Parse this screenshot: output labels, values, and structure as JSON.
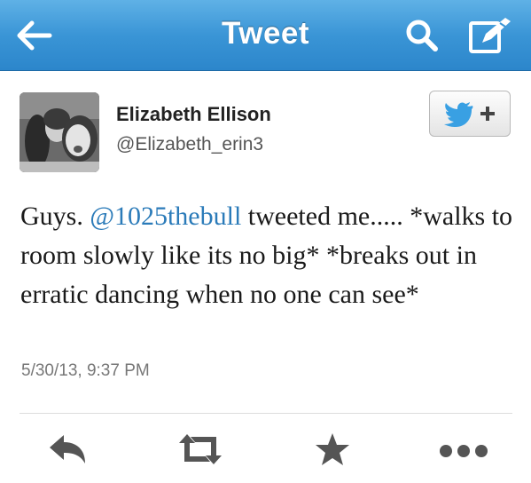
{
  "navbar": {
    "title": "Tweet",
    "background_color": "#3a95d6",
    "icons": [
      "back-arrow-icon",
      "search-icon",
      "compose-icon"
    ]
  },
  "tweet": {
    "user": {
      "name": "Elizabeth Ellison",
      "handle": "@Elizabeth_erin3"
    },
    "follow_icon": "twitter-bird-plus-icon",
    "text_before_mention": "Guys. ",
    "mention": "@1025thebull",
    "text_after_mention": " tweeted me..... *walks to room slowly like its no big* *breaks out in erratic dancing when no one can see*",
    "mention_color": "#2b7bb9",
    "timestamp": "5/30/13, 9:37 PM"
  },
  "actions": {
    "icons": [
      "reply-icon",
      "retweet-icon",
      "favorite-star-icon",
      "more-dots-icon"
    ],
    "icon_color": "#555555"
  }
}
